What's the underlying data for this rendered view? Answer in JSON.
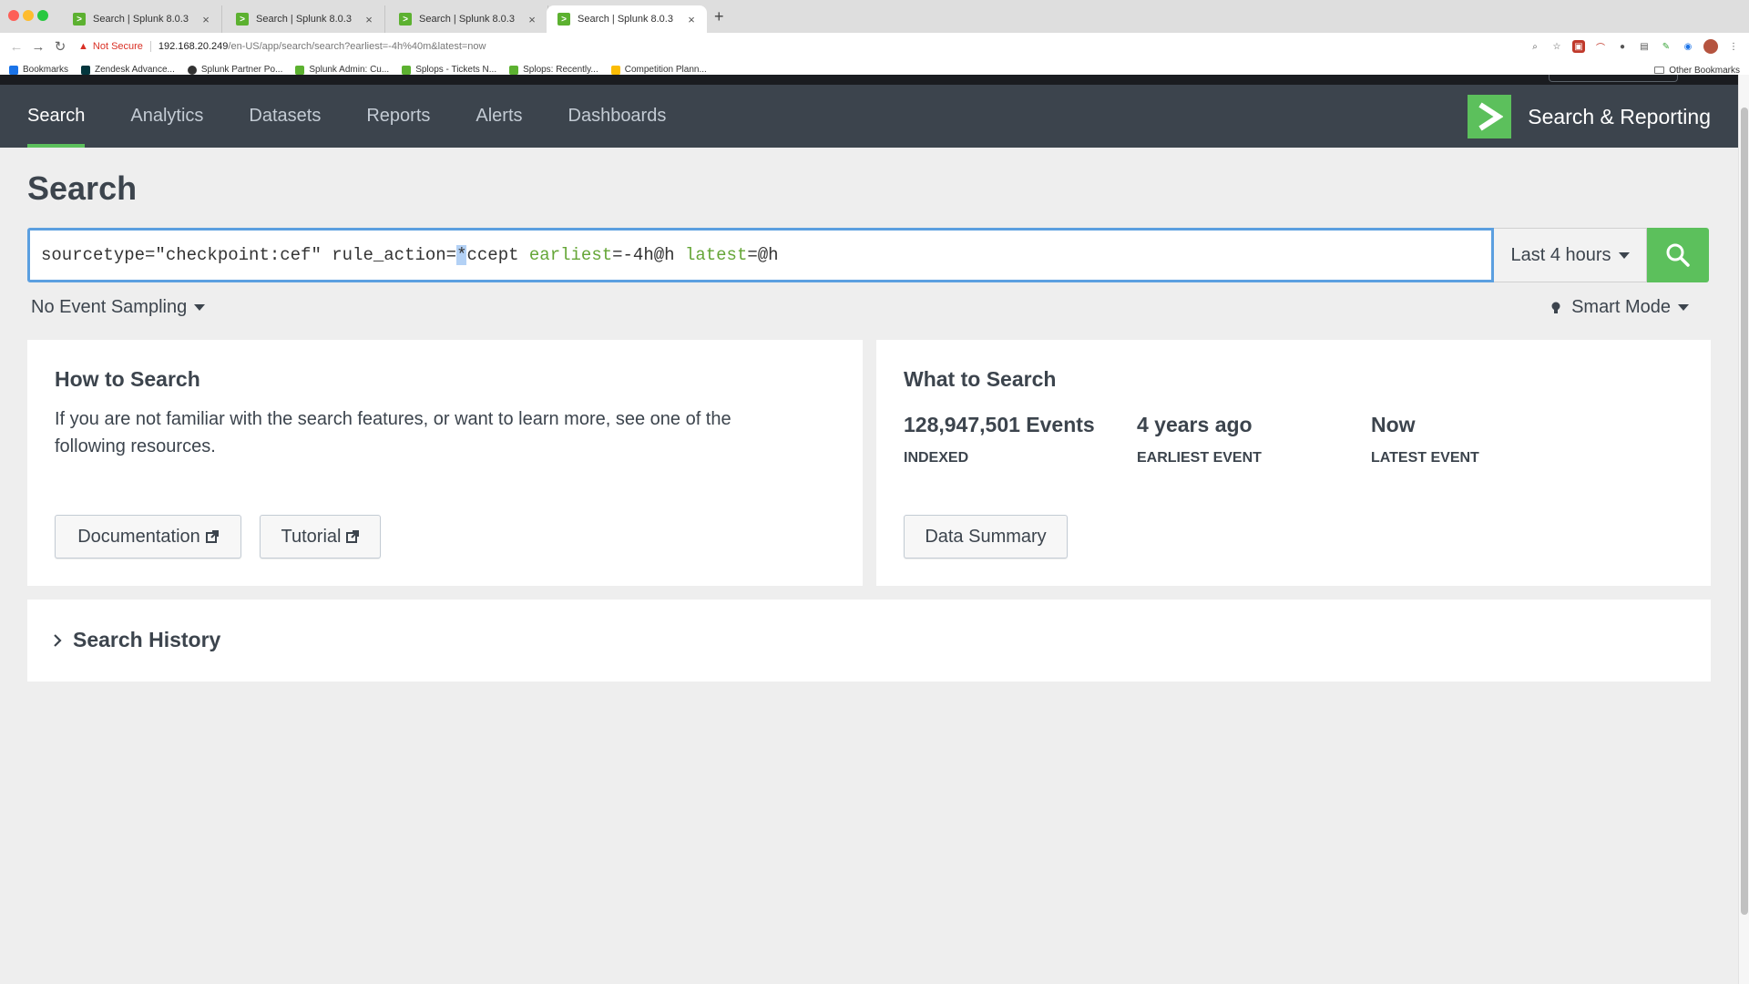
{
  "browser": {
    "tabs": [
      {
        "title": "Search | Splunk 8.0.3",
        "active": false
      },
      {
        "title": "Search | Splunk 8.0.3",
        "active": false
      },
      {
        "title": "Search | Splunk 8.0.3",
        "active": false
      },
      {
        "title": "Search | Splunk 8.0.3",
        "active": true
      }
    ],
    "new_tab": "+",
    "security_label": "Not Secure",
    "url_host": "192.168.20.249",
    "url_path": "/en-US/app/search/search?earliest=-4h%40m&latest=now",
    "bookmarks": [
      {
        "label": "Bookmarks",
        "color": "#1a73e8"
      },
      {
        "label": "Zendesk Advance...",
        "color": "#03363d"
      },
      {
        "label": "Splunk Partner Po...",
        "color": "#333333"
      },
      {
        "label": "Splunk Admin: Cu...",
        "color": "#5cb130"
      },
      {
        "label": "Splops - Tickets N...",
        "color": "#5cb130"
      },
      {
        "label": "Splops: Recently...",
        "color": "#5cb130"
      },
      {
        "label": "Competition Plann...",
        "color": "#fbbc04"
      }
    ],
    "other_bookmarks": "Other Bookmarks"
  },
  "app": {
    "nav": [
      {
        "label": "Search",
        "active": true
      },
      {
        "label": "Analytics",
        "active": false
      },
      {
        "label": "Datasets",
        "active": false
      },
      {
        "label": "Reports",
        "active": false
      },
      {
        "label": "Alerts",
        "active": false
      },
      {
        "label": "Dashboards",
        "active": false
      }
    ],
    "app_name": "Search & Reporting",
    "brand_color": "#5cc05c"
  },
  "search": {
    "page_title": "Search",
    "query": {
      "part1": "sourcetype=\"checkpoint:cef\" rule_action=",
      "selected": "*",
      "part2": "ccept ",
      "kw1": "earliest",
      "val1": "=-4h@h ",
      "kw2": "latest",
      "val2": "=@h"
    },
    "time_range": "Last 4 hours",
    "sampling": "No Event Sampling",
    "mode": "Smart Mode"
  },
  "how_to_search": {
    "title": "How to Search",
    "text": "If you are not familiar with the search features, or want to learn more, see one of the following resources.",
    "doc_button": "Documentation",
    "tutorial_button": "Tutorial"
  },
  "what_to_search": {
    "title": "What to Search",
    "stats": [
      {
        "value": "128,947,501 Events",
        "label": "INDEXED"
      },
      {
        "value": "4 years ago",
        "label": "EARLIEST EVENT"
      },
      {
        "value": "Now",
        "label": "LATEST EVENT"
      }
    ],
    "summary_button": "Data Summary"
  },
  "history": {
    "title": "Search History"
  }
}
